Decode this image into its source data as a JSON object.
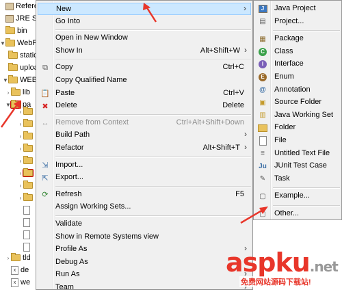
{
  "tree": {
    "items": [
      {
        "label": "Reference",
        "icon": "jar",
        "twisty": ""
      },
      {
        "label": "JRE Syste",
        "icon": "jar",
        "twisty": ""
      },
      {
        "label": "bin",
        "icon": "folder",
        "twisty": ""
      },
      {
        "label": "WebRoot",
        "icon": "folder",
        "twisty": "▼"
      },
      {
        "label": "static",
        "icon": "folder",
        "twisty": ""
      },
      {
        "label": "uploa",
        "icon": "folder",
        "twisty": ""
      },
      {
        "label": "WEB-I",
        "icon": "folder",
        "twisty": "▼"
      },
      {
        "label": "lib",
        "icon": "folder",
        "twisty": "›"
      },
      {
        "label": "pa",
        "icon": "folder",
        "twisty": "▼"
      }
    ],
    "bottom_items": [
      {
        "label": "tld",
        "icon": "folder"
      },
      {
        "label": "de",
        "icon": "xml"
      },
      {
        "label": "we",
        "icon": "xml"
      }
    ]
  },
  "menu": {
    "items": [
      {
        "label": "New",
        "shortcut": "",
        "submenu": true,
        "icon": "",
        "highlighted": true
      },
      {
        "label": "Go Into",
        "shortcut": "",
        "icon": ""
      },
      {
        "sep": true
      },
      {
        "label": "Open in New Window",
        "shortcut": "",
        "icon": ""
      },
      {
        "label": "Show In",
        "shortcut": "Alt+Shift+W",
        "submenu": true,
        "icon": ""
      },
      {
        "sep": true
      },
      {
        "label": "Copy",
        "shortcut": "Ctrl+C",
        "icon": "copy-icon"
      },
      {
        "label": "Copy Qualified Name",
        "shortcut": "",
        "icon": ""
      },
      {
        "label": "Paste",
        "shortcut": "Ctrl+V",
        "icon": "paste-icon"
      },
      {
        "label": "Delete",
        "shortcut": "Delete",
        "icon": "delete-icon"
      },
      {
        "sep": true
      },
      {
        "label": "Remove from Context",
        "shortcut": "Ctrl+Alt+Shift+Down",
        "icon": "remove-context-icon",
        "disabled": true
      },
      {
        "label": "Build Path",
        "shortcut": "",
        "submenu": true,
        "icon": ""
      },
      {
        "label": "Refactor",
        "shortcut": "Alt+Shift+T",
        "submenu": true,
        "icon": ""
      },
      {
        "sep": true
      },
      {
        "label": "Import...",
        "shortcut": "",
        "icon": "import-icon"
      },
      {
        "label": "Export...",
        "shortcut": "",
        "icon": "export-icon"
      },
      {
        "sep": true
      },
      {
        "label": "Refresh",
        "shortcut": "F5",
        "icon": "refresh-icon"
      },
      {
        "label": "Assign Working Sets...",
        "shortcut": "",
        "icon": ""
      },
      {
        "sep": true
      },
      {
        "label": "Validate",
        "shortcut": "",
        "icon": ""
      },
      {
        "label": "Show in Remote Systems view",
        "shortcut": "",
        "icon": ""
      },
      {
        "label": "Profile As",
        "shortcut": "",
        "submenu": true,
        "icon": ""
      },
      {
        "label": "Debug As",
        "shortcut": "",
        "submenu": true,
        "icon": ""
      },
      {
        "label": "Run As",
        "shortcut": "",
        "submenu": true,
        "icon": ""
      },
      {
        "label": "Team",
        "shortcut": "",
        "submenu": true,
        "icon": ""
      }
    ]
  },
  "submenu": {
    "items": [
      {
        "label": "Java Project",
        "icon": "java-project-icon"
      },
      {
        "label": "Project...",
        "icon": "project-icon"
      },
      {
        "sep": true
      },
      {
        "label": "Package",
        "icon": "package-icon"
      },
      {
        "label": "Class",
        "icon": "class-icon"
      },
      {
        "label": "Interface",
        "icon": "interface-icon"
      },
      {
        "label": "Enum",
        "icon": "enum-icon"
      },
      {
        "label": "Annotation",
        "icon": "annotation-icon"
      },
      {
        "label": "Source Folder",
        "icon": "source-folder-icon"
      },
      {
        "label": "Java Working Set",
        "icon": "working-set-icon"
      },
      {
        "label": "Folder",
        "icon": "folder-icon"
      },
      {
        "label": "File",
        "icon": "file-icon"
      },
      {
        "label": "Untitled Text File",
        "icon": "text-file-icon"
      },
      {
        "label": "JUnit Test Case",
        "icon": "junit-icon"
      },
      {
        "label": "Task",
        "icon": "task-icon"
      },
      {
        "sep": true
      },
      {
        "label": "Example...",
        "icon": "example-icon"
      },
      {
        "sep": true
      },
      {
        "label": "Other...",
        "icon": "other-icon"
      }
    ]
  },
  "watermark": {
    "main": "aspku",
    "net": ".net",
    "sub": "免费网站源码下载站!"
  },
  "colors": {
    "highlight": "#cce8ff",
    "menu_bg": "#f0f0f0",
    "arrow": "#e8362a"
  }
}
